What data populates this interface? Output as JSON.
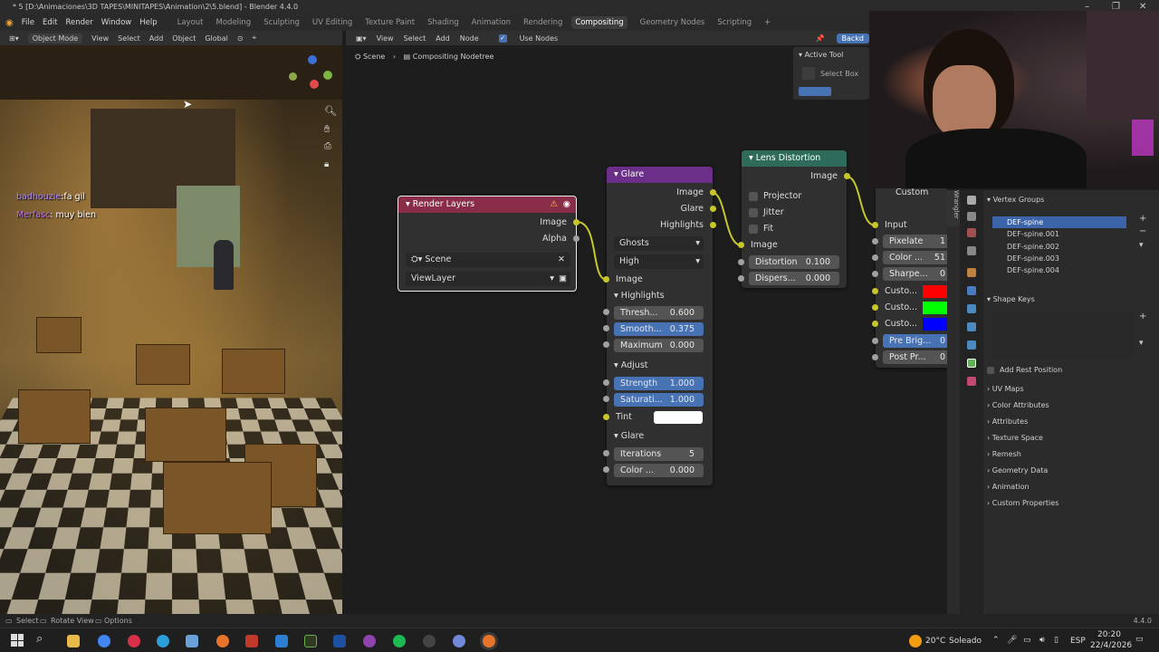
{
  "window": {
    "title": "* 5 [D:\\Animaciones\\3D TAPES\\MINITAPES\\Animation\\2\\5.blend] - Blender 4.4.0"
  },
  "menubar": {
    "items": [
      "File",
      "Edit",
      "Render",
      "Window",
      "Help"
    ],
    "workspaces": [
      "Layout",
      "Modeling",
      "Sculpting",
      "UV Editing",
      "Texture Paint",
      "Shading",
      "Animation",
      "Rendering",
      "Compositing",
      "Geometry Nodes",
      "Scripting"
    ],
    "active_workspace": "Compositing"
  },
  "viewport_header": {
    "mode": "Object Mode",
    "menus": [
      "View",
      "Select",
      "Add",
      "Object"
    ],
    "orientation": "Global"
  },
  "node_header": {
    "menus": [
      "View",
      "Select",
      "Add",
      "Node"
    ],
    "use_nodes_label": "Use Nodes",
    "use_nodes_checked": true,
    "backdrop_label": "Backd"
  },
  "breadcrumb": {
    "scene": "Scene",
    "tree": "Compositing Nodetree"
  },
  "active_tool": {
    "title": "Active Tool",
    "tool": "Select Box"
  },
  "chat": [
    {
      "user": "badhouzie",
      "message": "fa gil"
    },
    {
      "user": "Merfasc",
      "message": "muy bien"
    }
  ],
  "nodes": {
    "render_layers": {
      "title": "Render Layers",
      "outputs": [
        "Image",
        "Alpha"
      ],
      "scene": "Scene",
      "view_layer": "ViewLayer"
    },
    "glare": {
      "title": "Glare",
      "outputs": [
        "Image",
        "Glare",
        "Highlights"
      ],
      "type": "Ghosts",
      "quality": "High",
      "input_label": "Image",
      "sections": {
        "highlights": "Highlights",
        "adjust": "Adjust",
        "glare": "Glare"
      },
      "threshold": {
        "label": "Thresh...",
        "value": "0.600"
      },
      "smoothness": {
        "label": "Smooth...",
        "value": "0.375"
      },
      "maximum": {
        "label": "Maximum",
        "value": "0.000"
      },
      "strength": {
        "label": "Strength",
        "value": "1.000"
      },
      "saturation": {
        "label": "Saturati...",
        "value": "1.000"
      },
      "tint_label": "Tint",
      "iterations": {
        "label": "Iterations",
        "value": "5"
      },
      "color_mod": {
        "label": "Color ...",
        "value": "0.000"
      }
    },
    "lens_distortion": {
      "title": "Lens Distortion",
      "output": "Image",
      "options": [
        "Projector",
        "Jitter",
        "Fit"
      ],
      "input_label": "Image",
      "distortion": {
        "label": "Distortion",
        "value": "0.100"
      },
      "dispersion": {
        "label": "Dispers...",
        "value": "0.000"
      }
    },
    "custom": {
      "title": "Custom",
      "input_label": "Input",
      "fields": [
        {
          "label": "Pixelate",
          "value": "1"
        },
        {
          "label": "Color ...",
          "value": "51"
        },
        {
          "label": "Sharpe...",
          "value": "0"
        }
      ],
      "color_rows": [
        {
          "label": "Custo...",
          "color": "#ff0000"
        },
        {
          "label": "Custo...",
          "color": "#00ff00"
        },
        {
          "label": "Custo...",
          "color": "#0000ff"
        }
      ],
      "pre_brightness": {
        "label": "Pre Brig...",
        "value": "0"
      },
      "post_process": {
        "label": "Post Pr...",
        "value": "0"
      }
    }
  },
  "properties": {
    "vertex_groups_title": "Vertex Groups",
    "vertex_groups": [
      "DEF-spine",
      "DEF-spine.001",
      "DEF-spine.002",
      "DEF-spine.003",
      "DEF-spine.004"
    ],
    "shape_keys_title": "Shape Keys",
    "add_rest_position": "Add Rest Position",
    "sections": [
      "UV Maps",
      "Color Attributes",
      "Attributes",
      "Texture Space",
      "Remesh",
      "Geometry Data",
      "Animation",
      "Custom Properties"
    ]
  },
  "statusbar": {
    "items": [
      "Select",
      "Rotate View",
      "Options"
    ],
    "version": "4.4.0"
  },
  "taskbar": {
    "weather_temp": "20°C",
    "weather_text": "Soleado",
    "lang": "ESP",
    "time": "20:20",
    "date": "22/4/2026"
  }
}
